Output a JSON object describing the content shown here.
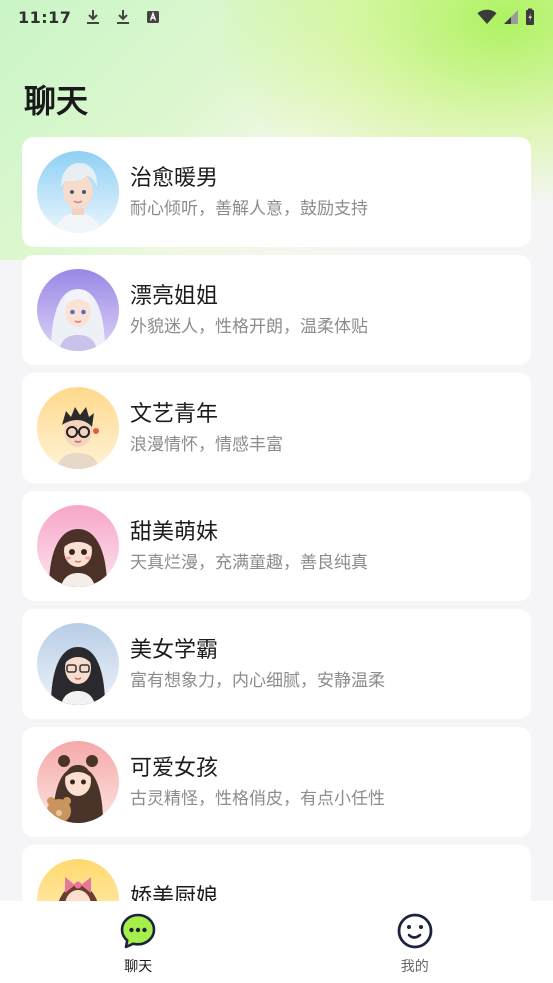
{
  "status_bar": {
    "time": "11:17"
  },
  "page": {
    "title": "聊天"
  },
  "characters": [
    {
      "name": "治愈暖男",
      "desc": "耐心倾听，善解人意，鼓励支持"
    },
    {
      "name": "漂亮姐姐",
      "desc": "外貌迷人，性格开朗，温柔体贴"
    },
    {
      "name": "文艺青年",
      "desc": "浪漫情怀，情感丰富"
    },
    {
      "name": "甜美萌妹",
      "desc": "天真烂漫，充满童趣，善良纯真"
    },
    {
      "name": "美女学霸",
      "desc": "富有想象力，内心细腻，安静温柔"
    },
    {
      "name": "可爱女孩",
      "desc": "古灵精怪，性格俏皮，有点小任性"
    },
    {
      "name": "娇美厨娘",
      "desc": ""
    }
  ],
  "tabs": [
    {
      "label": "聊天",
      "icon": "chat-bubble-icon",
      "active": true
    },
    {
      "label": "我的",
      "icon": "smiley-face-icon",
      "active": false
    }
  ],
  "colors": {
    "accent": "#a6ef4a",
    "tab_icon_dark": "#1c2340"
  }
}
